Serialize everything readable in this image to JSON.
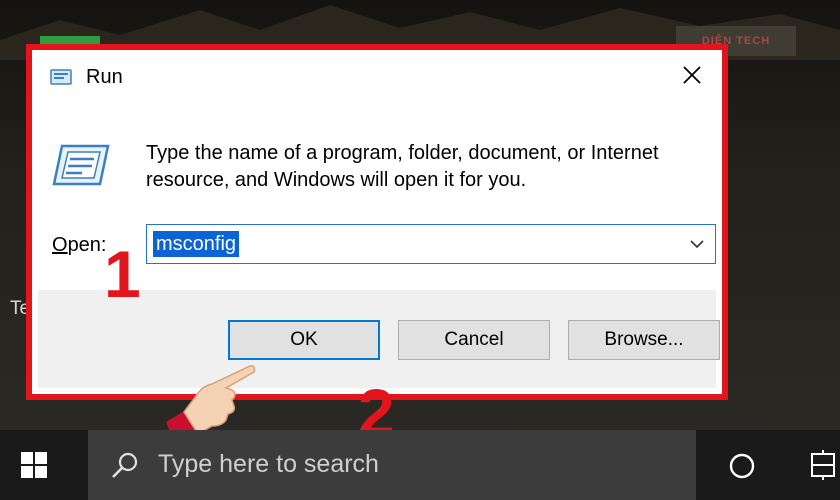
{
  "desktop": {
    "partial_text": "Te",
    "watermark": "DIỆN TECH"
  },
  "dialog": {
    "title": "Run",
    "description": "Type the name of a program, folder, document, or Internet resource, and Windows will open it for you.",
    "open_label_prefix": "O",
    "open_label_rest": "pen:",
    "command_value": "msconfig",
    "buttons": {
      "ok": "OK",
      "cancel": "Cancel",
      "browse": "Browse..."
    }
  },
  "annotations": {
    "step1": "1",
    "step2": "2",
    "highlight_color": "#e2141c"
  },
  "taskbar": {
    "search_placeholder": "Type here to search",
    "icons": [
      "windows-start-icon",
      "search-icon",
      "cortana-icon",
      "task-view-icon"
    ]
  },
  "colors": {
    "selection_blue": "#0a64d6",
    "focus_blue": "#0078d7",
    "taskbar": "#1a1a1a",
    "search_box": "#3c3c3c"
  }
}
